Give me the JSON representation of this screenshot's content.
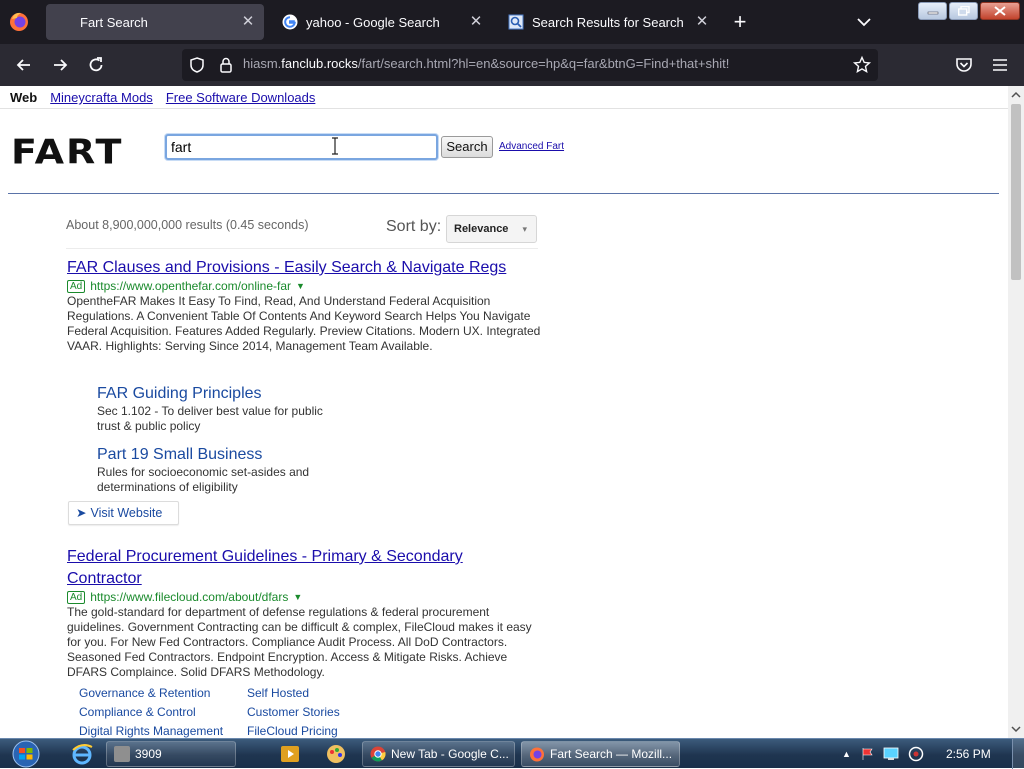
{
  "browser": {
    "tabs": [
      {
        "title": "Fart Search",
        "active": true
      },
      {
        "title": "yahoo - Google Search",
        "active": false
      },
      {
        "title": "Search Results for Search",
        "active": false
      }
    ],
    "url_prefix": "hiasm.",
    "url_domain": "fanclub.rocks",
    "url_suffix": "/fart/search.html?hl=en&source=hp&q=far&btnG=Find+that+shit!"
  },
  "page": {
    "topnav": {
      "current": "Web",
      "links": [
        "Mineycrafta Mods",
        "Free Software Downloads"
      ]
    },
    "logo": "FART",
    "search": {
      "value": "fart",
      "button": "Search",
      "advanced": "Advanced Fart"
    },
    "stats": "About 8,900,000,000 results (0.45 seconds)",
    "sort": {
      "label": "Sort by:",
      "value": "Relevance"
    },
    "results": [
      {
        "title": "FAR Clauses and Provisions - Easily Search & Navigate Regs",
        "ad": "Ad",
        "url": "https://www.openthefar.com/online-far",
        "desc": "OpentheFAR Makes It Easy To Find, Read, And Understand Federal Acquisition Regulations. A Convenient Table Of Contents And Keyword Search Helps You Navigate Federal Acquisition. Features Added Regularly. Preview Citations. Modern UX. Integrated VAAR. Highlights: Serving Since 2014, Management Team Available.",
        "sitelinks": [
          {
            "title": "FAR Guiding Principles",
            "desc": "Sec 1.102 - To deliver best value for public trust & public policy"
          },
          {
            "title": "Part 19 Small Business",
            "desc": "Rules for socioeconomic set-asides and determinations of eligibility"
          }
        ],
        "visit": "Visit Website"
      },
      {
        "title_line1": "Federal Procurement Guidelines - Primary & Secondary",
        "title_line2": "Contractor",
        "ad": "Ad",
        "url": "https://www.filecloud.com/about/dfars",
        "desc": "The gold-standard for department of defense regulations & federal procurement guidelines. Government Contracting can be difficult & complex, FileCloud makes it easy for you. For New Fed Contractors. Compliance Audit Process. All DoD Contractors. Seasoned Fed Contractors. Endpoint Encryption. Access & Mitigate Risks. Achieve DFARS Complaince. Solid DFARS Methodology.",
        "sitelinks": [
          "Governance & Retention",
          "Self Hosted",
          "Compliance & Control",
          "Customer Stories",
          "Digital Rights Management",
          "FileCloud Pricing"
        ]
      }
    ]
  },
  "taskbar": {
    "buttons": [
      "3909",
      "New Tab - Google C...",
      "Fart Search — Mozill..."
    ],
    "clock": "2:56 PM"
  },
  "colors": {
    "link": "#1a0dab",
    "ad_green": "#1a8a2c",
    "tab_bg": "#1c1b22",
    "nav_bg": "#2b2a33"
  }
}
